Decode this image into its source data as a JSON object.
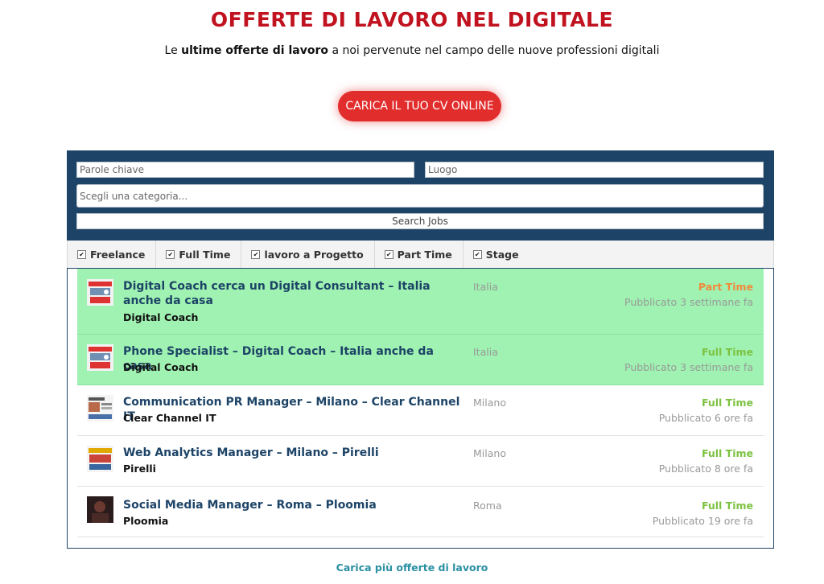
{
  "header": {
    "title": "OFFERTE DI LAVORO NEL DIGITALE",
    "subtitle_pre": "Le ",
    "subtitle_bold": "ultime offerte di lavoro",
    "subtitle_post": " a noi pervenute nel campo delle nuove professioni digitali",
    "cv_button": "CARICA IL TUO CV ONLINE"
  },
  "search": {
    "keywords_placeholder": "Parole chiave",
    "location_placeholder": "Luogo",
    "category_placeholder": "Scegli una categoria...",
    "button_label": "Search Jobs"
  },
  "filters": [
    {
      "label": "Freelance",
      "checked": true
    },
    {
      "label": "Full Time",
      "checked": true
    },
    {
      "label": "lavoro a Progetto",
      "checked": true
    },
    {
      "label": "Part Time",
      "checked": true
    },
    {
      "label": "Stage",
      "checked": true
    }
  ],
  "jobs": [
    {
      "title": "Digital Coach cerca un Digital Consultant – Italia anche da casa",
      "company": "Digital Coach",
      "location": "Italia",
      "type": "Part Time",
      "posted": "Pubblicato 3 settimane fa",
      "featured": true
    },
    {
      "title": "Phone Specialist – Digital Coach – Italia anche da casa",
      "company": "Digital Coach",
      "location": "Italia",
      "type": "Full Time",
      "posted": "Pubblicato 3 settimane fa",
      "featured": true
    },
    {
      "title": "Communication PR Manager – Milano – Clear Channel IT",
      "company": "Clear Channel IT",
      "location": "Milano",
      "type": "Full Time",
      "posted": "Pubblicato 6 ore fa",
      "featured": false
    },
    {
      "title": "Web Analytics Manager – Milano – Pirelli",
      "company": "Pirelli",
      "location": "Milano",
      "type": "Full Time",
      "posted": "Pubblicato 8 ore fa",
      "featured": false
    },
    {
      "title": "Social Media Manager – Roma – Ploomia",
      "company": "Ploomia",
      "location": "Roma",
      "type": "Full Time",
      "posted": "Pubblicato 19 ore fa",
      "featured": false
    }
  ],
  "colors": {
    "part_time": "#f08a3c",
    "full_time": "#7dc242"
  },
  "load_more": "Carica più offerte di lavoro"
}
